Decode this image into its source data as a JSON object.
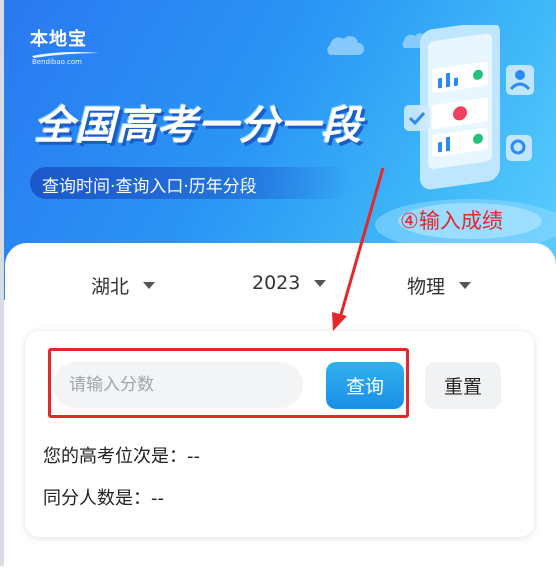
{
  "banner": {
    "logo": "本地宝",
    "logo_sub": "Bendibao.com",
    "title": "全国高考一分一段",
    "subtitle": "查询时间·查询入口·历年分段"
  },
  "annotation": {
    "text": "④输入成绩",
    "color": "#e5262b"
  },
  "selectors": {
    "province": "湖北",
    "year": "2023",
    "subject": "物理"
  },
  "query": {
    "input_value": "",
    "input_placeholder": "请输入分数",
    "query_label": "查询",
    "reset_label": "重置"
  },
  "results": {
    "rank": "您的高考位次是：--",
    "same_score": "同分人数是：--"
  },
  "colors": {
    "banner_start": "#2a78f0",
    "banner_end": "#5fd0ff",
    "accent": "#1a8fe6",
    "highlight": "#e5262b"
  }
}
